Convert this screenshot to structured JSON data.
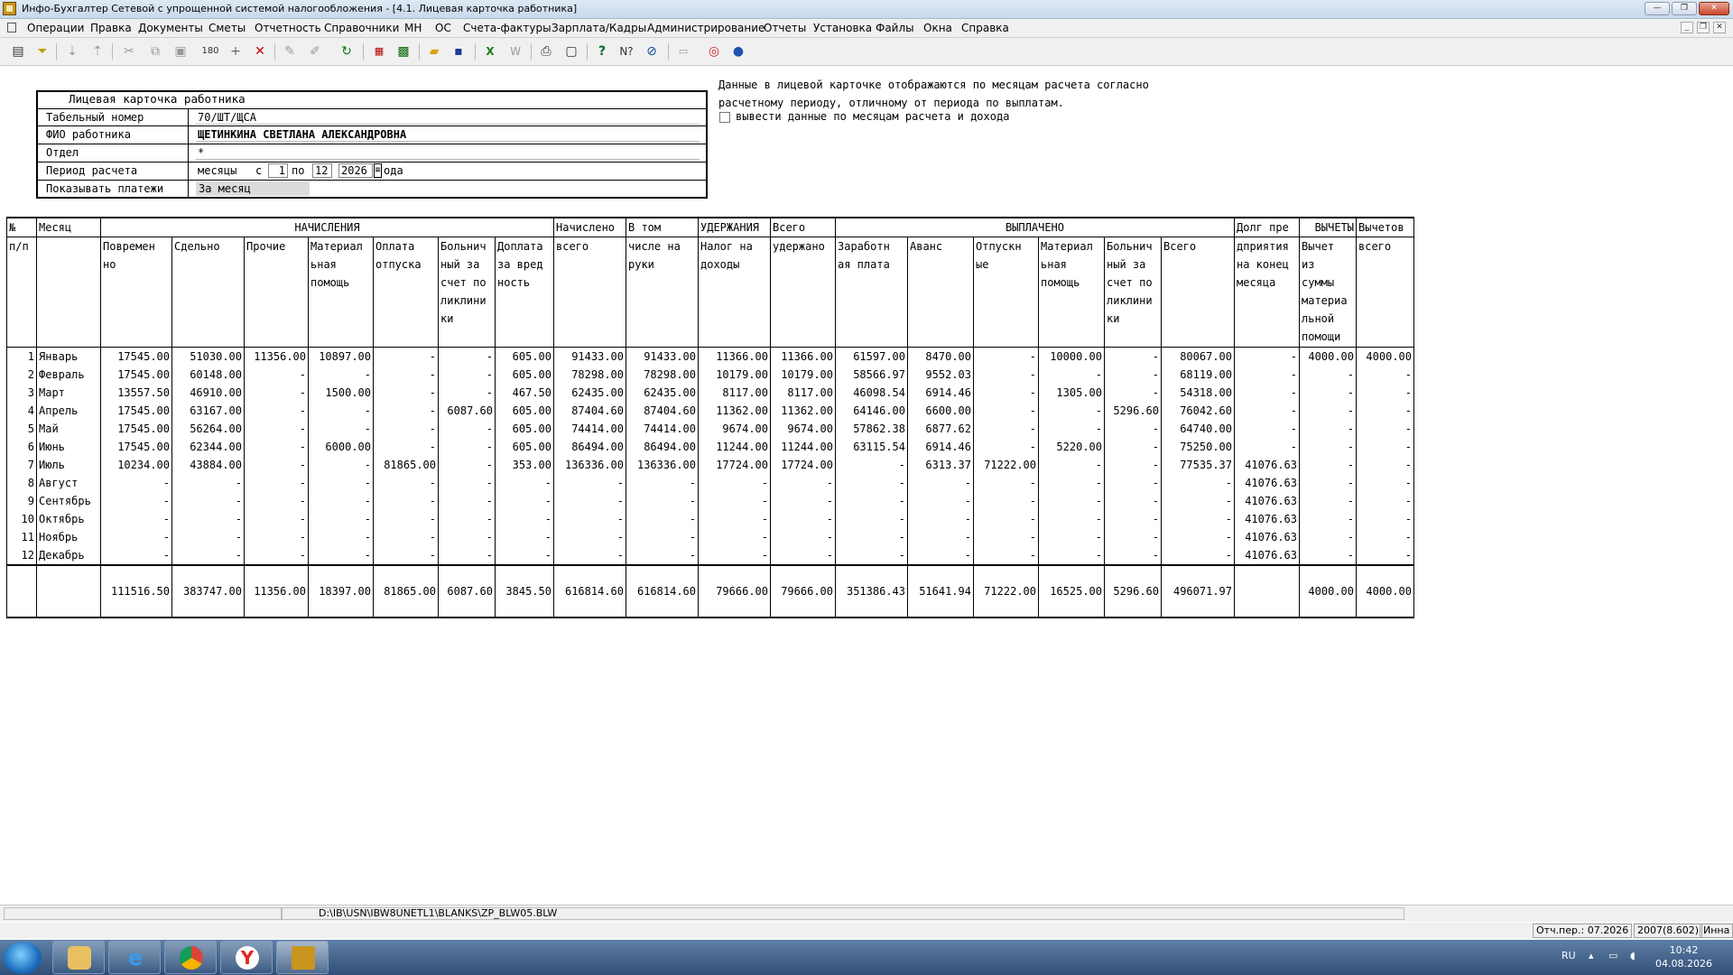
{
  "window": {
    "title": "Инфо-Бухгалтер Сетевой с упрощенной системой налогообложения - [4.1. Лицевая карточка работника]"
  },
  "menu": [
    "Операции",
    "Правка",
    "Документы",
    "Сметы",
    "Отчетность",
    "Справочники",
    "МН",
    "ОС",
    "Счета-фактуры",
    "Зарплата/Кадры",
    "Администрирование",
    "Отчеты",
    "Установка",
    "Файлы",
    "Окна",
    "Справка"
  ],
  "form": {
    "title": "Лицевая карточка работника",
    "tab_label": "Табельный номер",
    "tab_value": "70/ШТ/ЩСА",
    "fio_label": "ФИО работника",
    "fio_value": "ЩЕТИНКИНА СВЕТЛАНА АЛЕКСАНДРОВНА",
    "dept_label": "Отдел",
    "dept_value": "*",
    "period_label": "Период расчета",
    "period_unit": "месяцы",
    "period_from_label": "с",
    "period_from": "1",
    "period_to_label": "по",
    "period_to": "12",
    "period_year": "2026",
    "period_year_suffix": "ода",
    "payments_label": "Показывать платежи",
    "payments_value": "За месяц"
  },
  "note": {
    "line1": "Данные в лицевой карточке отображаются по месяцам расчета согласно",
    "line2": "расчетному периоду, отличному от периода по выплатам.",
    "checkbox_label": "вывести данные по месяцам расчета и дохода",
    "checkbox_checked": false
  },
  "table": {
    "header_groups": {
      "num": "№",
      "month": "Месяц",
      "nachisleniya": "НАЧИСЛЕНИЯ",
      "nachisleno": "Начислено",
      "vtom": "В том",
      "uderzhaniya": "УДЕРЖАНИЯ",
      "vsego": "Всего",
      "vyplacheno": "ВЫПЛАЧЕНО",
      "dolg": "Долг пре",
      "vychety": "ВЫЧЕТЫ",
      "vychetov": "Вычетов"
    },
    "header_sub": {
      "num": "п/п",
      "cols": [
        "Повремен\nно",
        "Сдельно",
        "Прочие",
        "Материал\nьная\nпомощь",
        "Оплата\nотпуска",
        "Больнич\nный за\nсчет по\nликлини\nки",
        "Доплата\nза вред\nность",
        "всего",
        "числе на\nруки",
        "Налог на\nдоходы",
        "удержано",
        "Заработн\nая плата",
        "Аванс",
        "Отпускн\nые",
        "Материал\nьная\nпомощь",
        "Больнич\nный за\nсчет по\nликлини\nки",
        "Всего",
        "дприятия\nна конец\nмесяца",
        "Вычет\nиз\nсуммы\nматериа\nльной\nпомощи",
        "всего"
      ]
    },
    "rows": [
      {
        "n": "1",
        "m": "Январь",
        "v": [
          "17545.00",
          "51030.00",
          "11356.00",
          "10897.00",
          "-",
          "-",
          "605.00",
          "91433.00",
          "91433.00",
          "11366.00",
          "11366.00",
          "61597.00",
          "8470.00",
          "-",
          "10000.00",
          "-",
          "80067.00",
          "-",
          "4000.00",
          "4000.00"
        ]
      },
      {
        "n": "2",
        "m": "Февраль",
        "v": [
          "17545.00",
          "60148.00",
          "-",
          "-",
          "-",
          "-",
          "605.00",
          "78298.00",
          "78298.00",
          "10179.00",
          "10179.00",
          "58566.97",
          "9552.03",
          "-",
          "-",
          "-",
          "68119.00",
          "-",
          "-",
          "-"
        ]
      },
      {
        "n": "3",
        "m": "Март",
        "v": [
          "13557.50",
          "46910.00",
          "-",
          "1500.00",
          "-",
          "-",
          "467.50",
          "62435.00",
          "62435.00",
          "8117.00",
          "8117.00",
          "46098.54",
          "6914.46",
          "-",
          "1305.00",
          "-",
          "54318.00",
          "-",
          "-",
          "-"
        ]
      },
      {
        "n": "4",
        "m": "Апрель",
        "v": [
          "17545.00",
          "63167.00",
          "-",
          "-",
          "-",
          "6087.60",
          "605.00",
          "87404.60",
          "87404.60",
          "11362.00",
          "11362.00",
          "64146.00",
          "6600.00",
          "-",
          "-",
          "5296.60",
          "76042.60",
          "-",
          "-",
          "-"
        ]
      },
      {
        "n": "5",
        "m": "Май",
        "v": [
          "17545.00",
          "56264.00",
          "-",
          "-",
          "-",
          "-",
          "605.00",
          "74414.00",
          "74414.00",
          "9674.00",
          "9674.00",
          "57862.38",
          "6877.62",
          "-",
          "-",
          "-",
          "64740.00",
          "-",
          "-",
          "-"
        ]
      },
      {
        "n": "6",
        "m": "Июнь",
        "v": [
          "17545.00",
          "62344.00",
          "-",
          "6000.00",
          "-",
          "-",
          "605.00",
          "86494.00",
          "86494.00",
          "11244.00",
          "11244.00",
          "63115.54",
          "6914.46",
          "-",
          "5220.00",
          "-",
          "75250.00",
          "-",
          "-",
          "-"
        ]
      },
      {
        "n": "7",
        "m": "Июль",
        "v": [
          "10234.00",
          "43884.00",
          "-",
          "-",
          "81865.00",
          "-",
          "353.00",
          "136336.00",
          "136336.00",
          "17724.00",
          "17724.00",
          "-",
          "6313.37",
          "71222.00",
          "-",
          "-",
          "77535.37",
          "41076.63",
          "-",
          "-"
        ]
      },
      {
        "n": "8",
        "m": "Август",
        "v": [
          "-",
          "-",
          "-",
          "-",
          "-",
          "-",
          "-",
          "-",
          "-",
          "-",
          "-",
          "-",
          "-",
          "-",
          "-",
          "-",
          "-",
          "41076.63",
          "-",
          "-"
        ]
      },
      {
        "n": "9",
        "m": "Сентябрь",
        "v": [
          "-",
          "-",
          "-",
          "-",
          "-",
          "-",
          "-",
          "-",
          "-",
          "-",
          "-",
          "-",
          "-",
          "-",
          "-",
          "-",
          "-",
          "41076.63",
          "-",
          "-"
        ]
      },
      {
        "n": "10",
        "m": "Октябрь",
        "v": [
          "-",
          "-",
          "-",
          "-",
          "-",
          "-",
          "-",
          "-",
          "-",
          "-",
          "-",
          "-",
          "-",
          "-",
          "-",
          "-",
          "-",
          "41076.63",
          "-",
          "-"
        ]
      },
      {
        "n": "11",
        "m": "Ноябрь",
        "v": [
          "-",
          "-",
          "-",
          "-",
          "-",
          "-",
          "-",
          "-",
          "-",
          "-",
          "-",
          "-",
          "-",
          "-",
          "-",
          "-",
          "-",
          "41076.63",
          "-",
          "-"
        ]
      },
      {
        "n": "12",
        "m": "Декабрь",
        "v": [
          "-",
          "-",
          "-",
          "-",
          "-",
          "-",
          "-",
          "-",
          "-",
          "-",
          "-",
          "-",
          "-",
          "-",
          "-",
          "-",
          "-",
          "41076.63",
          "-",
          "-"
        ]
      }
    ],
    "totals": [
      "111516.50",
      "383747.00",
      "11356.00",
      "18397.00",
      "81865.00",
      "6087.60",
      "3845.50",
      "616814.60",
      "616814.60",
      "79666.00",
      "79666.00",
      "351386.43",
      "51641.94",
      "71222.00",
      "16525.00",
      "5296.60",
      "496071.97",
      "",
      "4000.00",
      "4000.00"
    ]
  },
  "status": {
    "path": "D:\\IB\\USN\\IBW8UNETL1\\BLANKS\\ZP_BLW05.BLW"
  },
  "info": {
    "period": "Отч.пер.: 07.2026",
    "version": "2007(8.602)",
    "user": "Инна"
  },
  "taskbar": {
    "lang": "RU",
    "time": "10:42",
    "date": "04.08.2026"
  },
  "toolbar_icons": [
    "report-icon",
    "filter-icon",
    "sort-asc-icon",
    "sort-desc-icon",
    "cut-icon",
    "copy-icon",
    "paste-icon",
    "numbering-icon",
    "add-icon",
    "delete-icon",
    "mark-icon",
    "unmark-icon",
    "refresh-icon",
    "pdf-icon",
    "calculator-icon",
    "open-folder-icon",
    "save-icon",
    "excel-icon",
    "word-icon",
    "print-icon",
    "preview-icon",
    "help-icon",
    "context-help-icon",
    "navigate-icon",
    "keyboard-icon",
    "lifebuoy-icon",
    "web-icon"
  ]
}
